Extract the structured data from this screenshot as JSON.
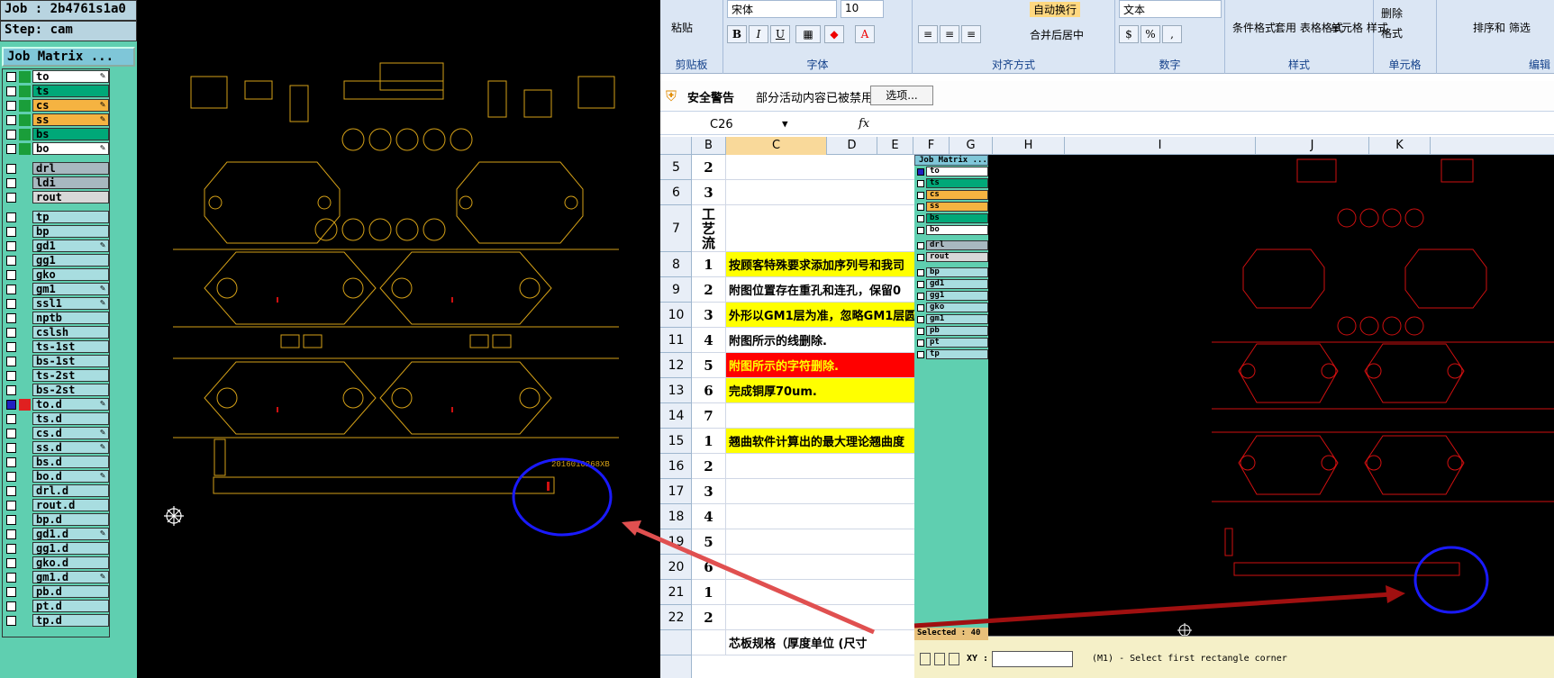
{
  "cam": {
    "job_label": "Job : 2b4761s1a0",
    "step_label": "Step: cam",
    "job_matrix_button": "Job Matrix ...",
    "board_text": "2016010268XB",
    "layers": [
      {
        "name": "to",
        "color": "#ffffff",
        "swatch": "#1a9e3a",
        "checked": false,
        "pen": true
      },
      {
        "name": "ts",
        "color": "#00a878",
        "swatch": "#1a9e3a",
        "checked": false,
        "pen": false
      },
      {
        "name": "cs",
        "color": "#f5b341",
        "swatch": "#1a9e3a",
        "checked": false,
        "pen": true
      },
      {
        "name": "ss",
        "color": "#f5b341",
        "swatch": "#1a9e3a",
        "checked": false,
        "pen": true
      },
      {
        "name": "bs",
        "color": "#00a878",
        "swatch": "#1a9e3a",
        "checked": false,
        "pen": false
      },
      {
        "name": "bo",
        "color": "#ffffff",
        "swatch": "#1a9e3a",
        "checked": false,
        "pen": true
      },
      {
        "gap": true
      },
      {
        "name": "drl",
        "color": "#a8b8c0",
        "swatch": "",
        "checked": false,
        "pen": false
      },
      {
        "name": "ldi",
        "color": "#a8b8c0",
        "swatch": "",
        "checked": false,
        "pen": false
      },
      {
        "name": "rout",
        "color": "#d8d8d8",
        "swatch": "",
        "checked": false,
        "pen": false
      },
      {
        "gap": true
      },
      {
        "name": "tp",
        "color": "#a8dde0",
        "swatch": "",
        "checked": false,
        "pen": false
      },
      {
        "name": "bp",
        "color": "#a8dde0",
        "swatch": "",
        "checked": false,
        "pen": false
      },
      {
        "name": "gd1",
        "color": "#a8dde0",
        "swatch": "",
        "checked": false,
        "pen": true
      },
      {
        "name": "gg1",
        "color": "#a8dde0",
        "swatch": "",
        "checked": false,
        "pen": false
      },
      {
        "name": "gko",
        "color": "#a8dde0",
        "swatch": "",
        "checked": false,
        "pen": false
      },
      {
        "name": "gm1",
        "color": "#a8dde0",
        "swatch": "",
        "checked": false,
        "pen": true
      },
      {
        "name": "ssl1",
        "color": "#a8dde0",
        "swatch": "",
        "checked": false,
        "pen": true
      },
      {
        "name": "nptb",
        "color": "#a8dde0",
        "swatch": "",
        "checked": false,
        "pen": false
      },
      {
        "name": "cslsh",
        "color": "#a8dde0",
        "swatch": "",
        "checked": false,
        "pen": false
      },
      {
        "name": "ts-1st",
        "color": "#a8dde0",
        "swatch": "",
        "checked": false,
        "pen": false
      },
      {
        "name": "bs-1st",
        "color": "#a8dde0",
        "swatch": "",
        "checked": false,
        "pen": false
      },
      {
        "name": "ts-2st",
        "color": "#a8dde0",
        "swatch": "",
        "checked": false,
        "pen": false
      },
      {
        "name": "bs-2st",
        "color": "#a8dde0",
        "swatch": "",
        "checked": false,
        "pen": false
      },
      {
        "name": "to.d",
        "color": "#a8dde0",
        "swatch": "#e02020",
        "checked": true,
        "pen": true
      },
      {
        "name": "ts.d",
        "color": "#a8dde0",
        "swatch": "",
        "checked": false,
        "pen": false
      },
      {
        "name": "cs.d",
        "color": "#a8dde0",
        "swatch": "",
        "checked": false,
        "pen": true
      },
      {
        "name": "ss.d",
        "color": "#a8dde0",
        "swatch": "",
        "checked": false,
        "pen": true
      },
      {
        "name": "bs.d",
        "color": "#a8dde0",
        "swatch": "",
        "checked": false,
        "pen": false
      },
      {
        "name": "bo.d",
        "color": "#a8dde0",
        "swatch": "",
        "checked": false,
        "pen": true
      },
      {
        "name": "drl.d",
        "color": "#a8dde0",
        "swatch": "",
        "checked": false,
        "pen": false
      },
      {
        "name": "rout.d",
        "color": "#a8dde0",
        "swatch": "",
        "checked": false,
        "pen": false
      },
      {
        "name": "bp.d",
        "color": "#a8dde0",
        "swatch": "",
        "checked": false,
        "pen": false
      },
      {
        "name": "gd1.d",
        "color": "#a8dde0",
        "swatch": "",
        "checked": false,
        "pen": true
      },
      {
        "name": "gg1.d",
        "color": "#a8dde0",
        "swatch": "",
        "checked": false,
        "pen": false
      },
      {
        "name": "gko.d",
        "color": "#a8dde0",
        "swatch": "",
        "checked": false,
        "pen": false
      },
      {
        "name": "gm1.d",
        "color": "#a8dde0",
        "swatch": "",
        "checked": false,
        "pen": true
      },
      {
        "name": "pb.d",
        "color": "#a8dde0",
        "swatch": "",
        "checked": false,
        "pen": false
      },
      {
        "name": "pt.d",
        "color": "#a8dde0",
        "swatch": "",
        "checked": false,
        "pen": false
      },
      {
        "name": "tp.d",
        "color": "#a8dde0",
        "swatch": "",
        "checked": false,
        "pen": false
      }
    ]
  },
  "excel": {
    "ribbon": {
      "paste": "粘贴",
      "clipboard": "剪贴板",
      "font_name": "宋体",
      "font_size": "10",
      "font": "字体",
      "wrap_text": "自动换行",
      "merge_center": "合并后居中",
      "alignment": "对齐方式",
      "number_format": "文本",
      "number": "数字",
      "cond_format": "条件格式",
      "table_format": "套用\n表格格式",
      "cell_style": "单元格\n样式",
      "styles": "样式",
      "delete": "删除",
      "format": "格式",
      "cells": "单元格",
      "sort_filter": "排序和\n筛选",
      "edit": "编辑"
    },
    "security": {
      "title": "安全警告",
      "message": "部分活动内容已被禁用。",
      "options_button": "选项..."
    },
    "name_box": "C26",
    "fx": "fx",
    "columns": [
      "B",
      "C",
      "D",
      "E",
      "F",
      "G",
      "H",
      "I",
      "J",
      "K"
    ],
    "rows": [
      {
        "num": "5",
        "b": "2",
        "c": "",
        "fill": ""
      },
      {
        "num": "6",
        "b": "3",
        "c": "",
        "fill": ""
      },
      {
        "num": "7",
        "b": "工\n艺\n流",
        "c": "",
        "fill": ""
      },
      {
        "num": "8",
        "b": "1",
        "c": "按顾客特殊要求添加序列号和我司",
        "fill": "#ffff00"
      },
      {
        "num": "9",
        "b": "2",
        "c": "附图位置存在重孔和连孔，保留0",
        "fill": ""
      },
      {
        "num": "10",
        "b": "3",
        "c": "外形以GM1层为准，忽略GM1层圆",
        "fill": "#ffff00"
      },
      {
        "num": "11",
        "b": "4",
        "c": "附图所示的线删除.",
        "fill": ""
      },
      {
        "num": "12",
        "b": "5",
        "c": "附图所示的字符删除.",
        "fill": "#ff0000"
      },
      {
        "num": "13",
        "b": "6",
        "c": "完成铜厚70um.",
        "fill": "#ffff00"
      },
      {
        "num": "14",
        "b": "7",
        "c": "",
        "fill": ""
      },
      {
        "num": "15",
        "b": "1",
        "c": "翘曲软件计算出的最大理论翘曲度",
        "fill": "#ffff00"
      },
      {
        "num": "16",
        "b": "2",
        "c": "",
        "fill": ""
      },
      {
        "num": "17",
        "b": "3",
        "c": "",
        "fill": ""
      },
      {
        "num": "18",
        "b": "4",
        "c": "",
        "fill": ""
      },
      {
        "num": "19",
        "b": "5",
        "c": "",
        "fill": ""
      },
      {
        "num": "20",
        "b": "6",
        "c": "",
        "fill": ""
      },
      {
        "num": "21",
        "b": "1",
        "c": "",
        "fill": ""
      },
      {
        "num": "22",
        "b": "2",
        "c": "",
        "fill": ""
      },
      {
        "num": "",
        "b": "",
        "c": "芯板规格（厚度单位   (尺寸",
        "fill": ""
      }
    ],
    "inner_cam": {
      "title": "Job Matrix ...",
      "selected": "Selected : 40",
      "xy_label": "XY :",
      "status": "(M1) - Select first rectangle corner",
      "layers": [
        {
          "name": "to",
          "color": "#ffffff",
          "checked": true
        },
        {
          "name": "ts",
          "color": "#00a878",
          "checked": false
        },
        {
          "name": "cs",
          "color": "#f5b341",
          "checked": false
        },
        {
          "name": "ss",
          "color": "#f5b341",
          "checked": false
        },
        {
          "name": "bs",
          "color": "#00a878",
          "checked": false
        },
        {
          "name": "bo",
          "color": "#ffffff",
          "checked": false
        },
        {
          "gap": true
        },
        {
          "name": "drl",
          "color": "#a8b8c0",
          "checked": false
        },
        {
          "name": "rout",
          "color": "#d8d8d8",
          "checked": false
        },
        {
          "gap": true
        },
        {
          "name": "bp",
          "color": "#a8dde0",
          "checked": false
        },
        {
          "name": "gd1",
          "color": "#a8dde0",
          "checked": false
        },
        {
          "name": "gg1",
          "color": "#a8dde0",
          "checked": false
        },
        {
          "name": "gko",
          "color": "#a8dde0",
          "checked": false
        },
        {
          "name": "gm1",
          "color": "#a8dde0",
          "checked": false
        },
        {
          "name": "pb",
          "color": "#a8dde0",
          "checked": false
        },
        {
          "name": "pt",
          "color": "#a8dde0",
          "checked": false
        },
        {
          "name": "tp",
          "color": "#a8dde0",
          "checked": false
        }
      ]
    }
  },
  "colors": {
    "pcb_yellow": "#d4a017",
    "pcb_red": "#d01010",
    "highlight_blue": "#1a1aff",
    "arrow_red": "#e05050"
  }
}
